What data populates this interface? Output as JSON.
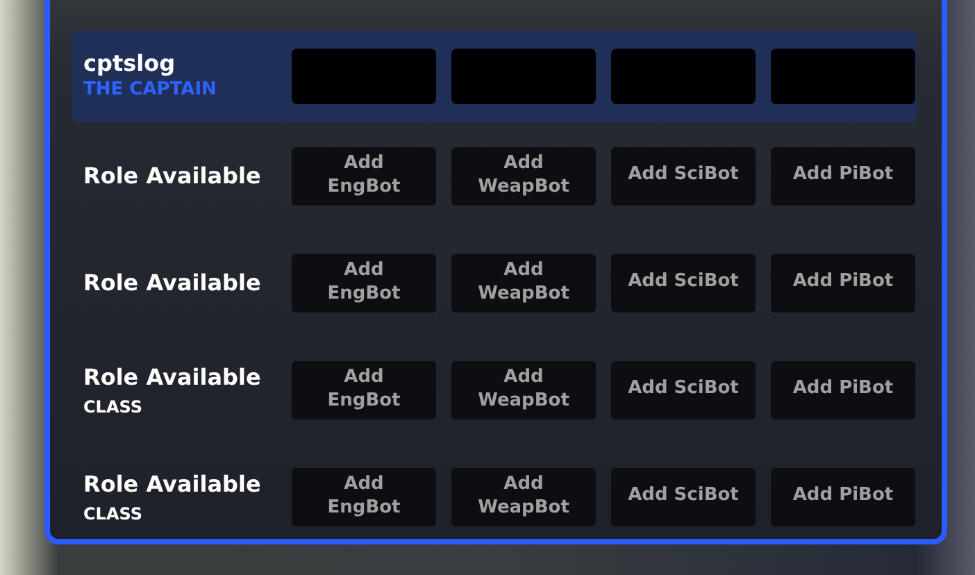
{
  "captain": {
    "name": "cptslog",
    "role": "THE CAPTAIN",
    "slots": [
      {
        "kind": "empty"
      },
      {
        "kind": "empty"
      },
      {
        "kind": "empty"
      },
      {
        "kind": "empty"
      }
    ]
  },
  "rows": [
    {
      "title": "Role Available",
      "buttons": [
        "Add EngBot",
        "Add WeapBot",
        "Add SciBot",
        "Add PiBot"
      ]
    },
    {
      "title": "Role Available",
      "buttons": [
        "Add EngBot",
        "Add WeapBot",
        "Add SciBot",
        "Add PiBot"
      ]
    },
    {
      "title": "Role Available",
      "subtitle": "CLASS",
      "buttons": [
        "Add EngBot",
        "Add WeapBot",
        "Add SciBot",
        "Add PiBot"
      ]
    },
    {
      "title": "Role Available",
      "subtitle": "CLASS",
      "buttons": [
        "Add EngBot",
        "Add WeapBot",
        "Add SciBot",
        "Add PiBot"
      ]
    }
  ]
}
